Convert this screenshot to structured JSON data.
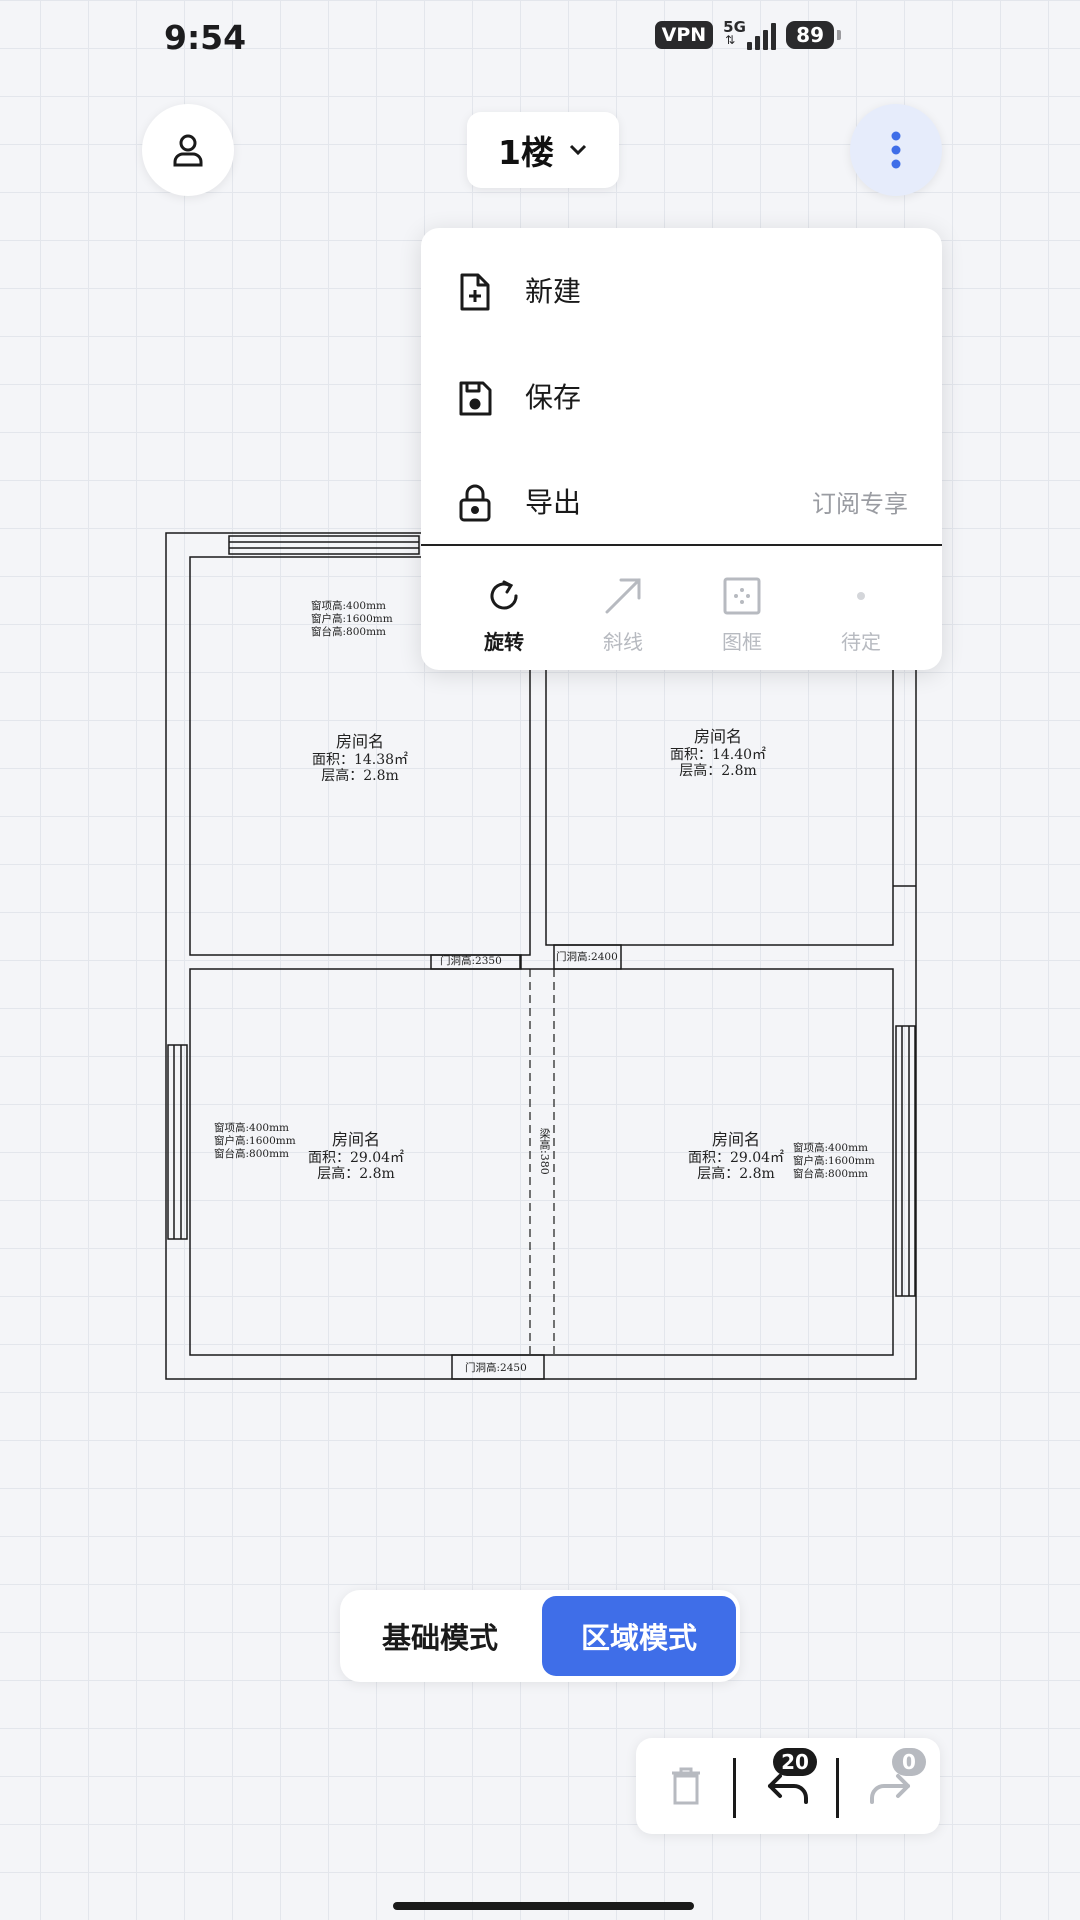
{
  "status": {
    "time": "9:54",
    "vpn": "VPN",
    "network": "5G",
    "battery": "89"
  },
  "header": {
    "floor_label": "1楼"
  },
  "menu": {
    "items": [
      {
        "label": "新建",
        "icon": "file-plus-icon"
      },
      {
        "label": "保存",
        "icon": "save-icon"
      },
      {
        "label": "导出",
        "icon": "lock-icon",
        "extra": "订阅专享"
      }
    ],
    "tools": [
      {
        "label": "旋转",
        "icon": "rotate-icon",
        "active": true
      },
      {
        "label": "斜线",
        "icon": "diagonal-arrow-icon",
        "active": false
      },
      {
        "label": "图框",
        "icon": "frame-icon",
        "active": false
      },
      {
        "label": "待定",
        "icon": "dot-icon",
        "active": false
      }
    ]
  },
  "plan": {
    "rooms": [
      {
        "name": "房间名",
        "area": "面积：14.38㎡",
        "height": "层高：2.8m"
      },
      {
        "name": "房间名",
        "area": "面积：14.40㎡",
        "height": "层高：2.8m"
      },
      {
        "name": "房间名",
        "area": "面积：29.04㎡",
        "height": "层高：2.8m"
      },
      {
        "name": "房间名",
        "area": "面积：29.04㎡",
        "height": "层高：2.8m"
      }
    ],
    "windows": [
      {
        "top": "窗项高:400mm",
        "win": "窗户高:1600mm",
        "sill": "窗台高:800mm"
      },
      {
        "top": "窗项高:400mm",
        "win": "窗户高:1600mm",
        "sill": "窗台高:800mm"
      },
      {
        "top": "窗项高:400mm",
        "win": "窗户高:1600mm",
        "sill": "窗台高:800mm"
      }
    ],
    "doors": [
      "门洞高:2350",
      "门洞高:2400",
      "门洞高:2450"
    ],
    "beam": "梁高:380"
  },
  "mode": {
    "basic": "基础模式",
    "area": "区域模式"
  },
  "history": {
    "undo_count": "20",
    "redo_count": "0"
  },
  "colors": {
    "accent": "#3f6ee8",
    "inactive": "#b7bac0"
  }
}
